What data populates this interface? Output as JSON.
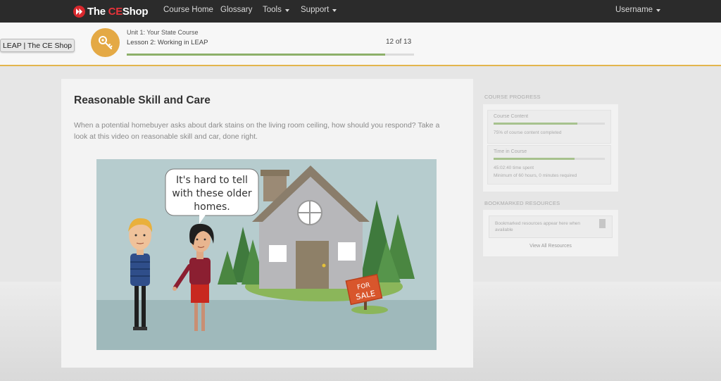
{
  "navbar": {
    "brand": {
      "the": "The",
      "ce": "CE",
      "shop": "Shop"
    },
    "items": [
      {
        "label": "Course Home",
        "has_caret": false
      },
      {
        "label": "Glossary",
        "has_caret": false
      },
      {
        "label": "Tools",
        "has_caret": true
      },
      {
        "label": "Support",
        "has_caret": true
      }
    ],
    "user": {
      "label": "Username"
    }
  },
  "lesson_header": {
    "unit": "Unit 1: Your State Course",
    "lesson": "Lesson 2: Working in LEAP",
    "counter": "12 of 13",
    "progress_fraction": 0.9,
    "accent": "#e4a945"
  },
  "tooltip": {
    "text": "LEAP | The CE Shop"
  },
  "content": {
    "title": "Reasonable Skill and Care",
    "intro": "When a potential homebuyer asks about dark stains on the living room ceiling, how should you respond? Take a look at this video on reasonable skill and car, done right.",
    "video": {
      "speech": [
        "It's hard to tell",
        "with these older",
        "homes."
      ],
      "sign": [
        "FOR",
        "SALE"
      ]
    }
  },
  "sidebar": {
    "progress_heading": "COURSE PROGRESS",
    "content_label": "Course Content",
    "content_fraction": 0.75,
    "content_sub": "75% of course content completed",
    "time_label": "Time in Course",
    "time_fraction": 0.73,
    "time_sub": "45:02:40 time spent",
    "time_min": "Minimum of 60 hours, 0 minutes required",
    "bookmarks_heading": "BOOKMARKED RESOURCES",
    "bookmarks_text": "Bookmarked resources appear here when available",
    "view_all": "View All Resources"
  },
  "colors": {
    "navbar": "#2b2b2b",
    "brand_red": "#d8282d",
    "progress_green": "#8db06a",
    "header_border": "#e3b54d"
  }
}
